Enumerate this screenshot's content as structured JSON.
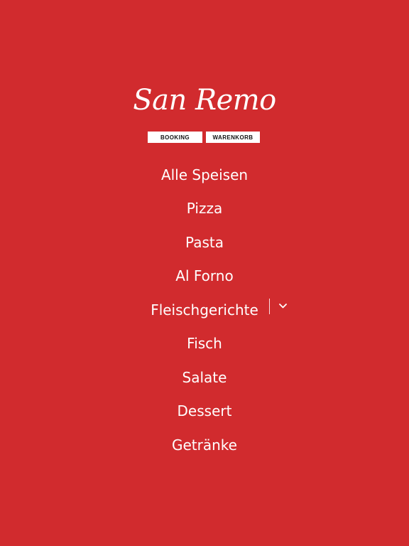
{
  "brand": {
    "logo_text": "San Remo"
  },
  "top_buttons": {
    "booking_label": "BOOKING",
    "cart_label": "WARENKORB"
  },
  "menu": {
    "items": [
      {
        "label": "Alle Speisen"
      },
      {
        "label": "Pizza"
      },
      {
        "label": "Pasta"
      },
      {
        "label": "Al Forno"
      },
      {
        "label": "Fleischgerichte",
        "has_submenu": true
      },
      {
        "label": "Fisch"
      },
      {
        "label": "Salate"
      },
      {
        "label": "Dessert"
      },
      {
        "label": "Getränke"
      }
    ],
    "submenu_icon": "chevron-down-icon"
  },
  "colors": {
    "background": "#d12b2e",
    "text": "#ffffff"
  }
}
